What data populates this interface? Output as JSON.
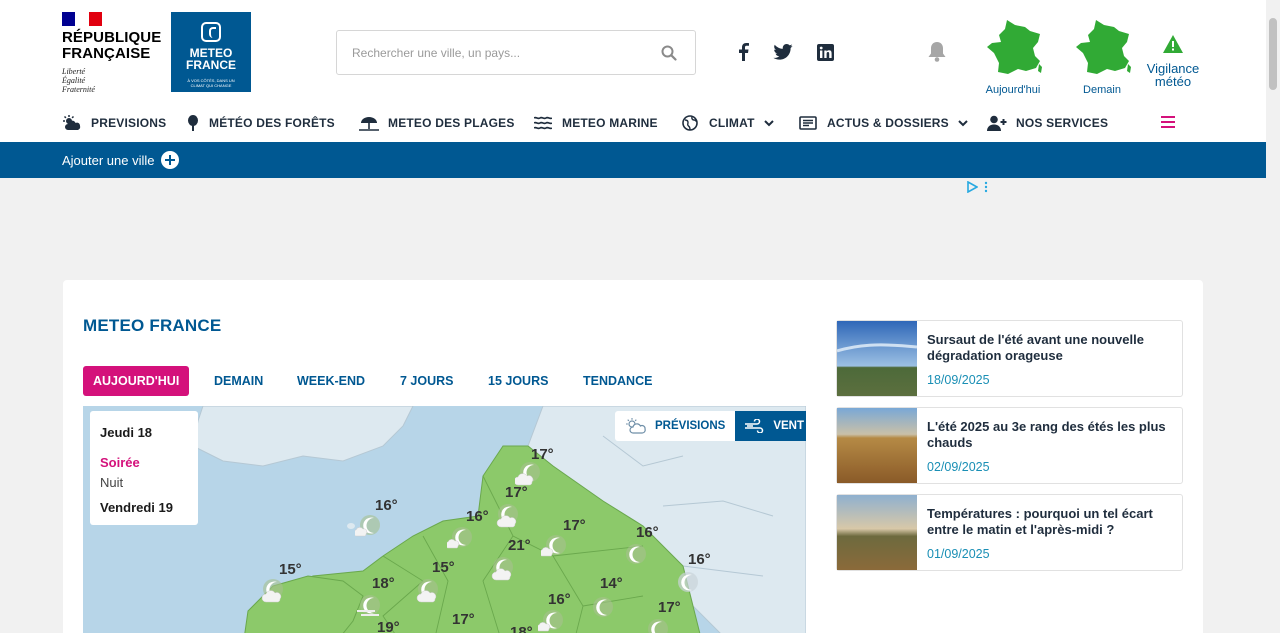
{
  "header": {
    "rf_name": "RÉPUBLIQUE FRANÇAISE",
    "rf_name_line1": "RÉPUBLIQUE",
    "rf_name_line2": "FRANÇAISE",
    "rf_motto": [
      "Liberté",
      "Égalité",
      "Fraternité"
    ],
    "mf_logo_line1": "METEO",
    "mf_logo_line2": "FRANCE",
    "mf_logo_tagline": "À VOS CÔTÉS, DANS UN CLIMAT QUI CHANGE",
    "search_placeholder": "Rechercher une ville, un pays...",
    "social": [
      "facebook-icon",
      "twitter-icon",
      "linkedin-icon"
    ],
    "vigilance_today": "Aujourd'hui",
    "vigilance_tomorrow": "Demain",
    "vigilance_label_1": "Vigilance",
    "vigilance_label_2": "météo"
  },
  "nav": {
    "items": [
      {
        "label": "PREVISIONS",
        "icon": "weather-icon"
      },
      {
        "label": "MÉTÉO DES FORÊTS",
        "icon": "tree-icon"
      },
      {
        "label": "METEO DES PLAGES",
        "icon": "umbrella-icon"
      },
      {
        "label": "METEO MARINE",
        "icon": "waves-icon"
      },
      {
        "label": "CLIMAT",
        "icon": "globe-icon"
      },
      {
        "label": "ACTUS & DOSSIERS",
        "icon": "news-icon"
      },
      {
        "label": "NOS SERVICES",
        "icon": "user-plus-icon"
      }
    ]
  },
  "bluebar": {
    "add_city": "Ajouter une ville"
  },
  "main": {
    "title": "METEO FRANCE",
    "tabs": [
      "AUJOURD'HUI",
      "DEMAIN",
      "WEEK-END",
      "7 JOURS",
      "15 JOURS",
      "TENDANCE"
    ],
    "active_tab": 0,
    "day_panel": {
      "day1": "Jeudi 18",
      "period_active": "Soirée",
      "period2": "Nuit",
      "day2": "Vendredi 19"
    },
    "toggle": {
      "previsions": "PRÉVISIONS",
      "vent": "VENT",
      "active": "VENT"
    },
    "map_temps": [
      "17°",
      "17°",
      "16°",
      "16°",
      "17°",
      "21°",
      "16°",
      "16°",
      "15°",
      "18°",
      "15°",
      "14°",
      "16°",
      "17°",
      "17°",
      "19°",
      "18°"
    ]
  },
  "articles": [
    {
      "title": "Sursaut de l'été avant une nouvelle dégradation orageuse",
      "date": "18/09/2025"
    },
    {
      "title": "L'été 2025 au 3e rang des étés les plus chauds",
      "date": "02/09/2025"
    },
    {
      "title": "Températures : pourquoi un tel écart entre le matin et l'après-midi ?",
      "date": "01/09/2025"
    }
  ],
  "colors": {
    "brand_blue": "#005892",
    "accent_pink": "#d4117b",
    "vigilance_green": "#31aa35",
    "map_land": "#8cc96a",
    "map_sea": "#b7d5e8"
  }
}
